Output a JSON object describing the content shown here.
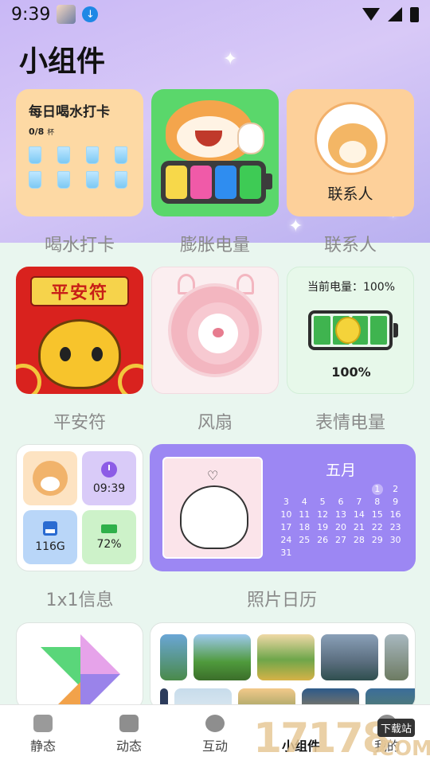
{
  "status_bar": {
    "time": "9:39",
    "icons": [
      "avatar-icon",
      "download-icon",
      "wifi-icon",
      "signal-icon",
      "battery-icon"
    ]
  },
  "page_title": "小组件",
  "widgets": {
    "water": {
      "title": "每日喝水打卡",
      "count": "0/8",
      "unit": "杯",
      "label": "喝水打卡"
    },
    "cat_battery": {
      "label": "膨胀电量"
    },
    "contact": {
      "name": "联系人",
      "label": "联系人"
    },
    "pinganfu": {
      "banner": "平安符",
      "label": "平安符"
    },
    "fan": {
      "label": "风扇"
    },
    "emoji_battery": {
      "header": "当前电量：100%",
      "percent": "100%",
      "level": 1.0,
      "label": "表情电量"
    },
    "info": {
      "time": "09:39",
      "storage": "116G",
      "battery": "72%",
      "label": "1x1信息"
    },
    "photo_calendar": {
      "month": "五月",
      "today": "1",
      "days": [
        "",
        "",
        "",
        "",
        "",
        "1",
        "2",
        "3",
        "4",
        "5",
        "6",
        "7",
        "8",
        "9",
        "10",
        "11",
        "12",
        "13",
        "14",
        "15",
        "16",
        "17",
        "18",
        "19",
        "20",
        "21",
        "22",
        "23",
        "24",
        "25",
        "26",
        "27",
        "28",
        "29",
        "30",
        "31",
        "",
        "",
        "",
        ""
      ],
      "label": "照片日历"
    }
  },
  "tabs": [
    {
      "label": "静态",
      "icon": "image-icon",
      "active": false
    },
    {
      "label": "动态",
      "icon": "star-icon",
      "active": false
    },
    {
      "label": "互动",
      "icon": "planet-icon",
      "active": false
    },
    {
      "label": "小组件",
      "icon": "widget-icon",
      "active": true
    },
    {
      "label": "我的",
      "icon": "person-icon",
      "active": false
    }
  ],
  "watermark": {
    "number": "17178",
    "tag": "下载站",
    "suffix": ".COM"
  },
  "colors": {
    "accent_purple": "#9c87f3",
    "water_bg": "#fdd9a4",
    "cat_bg": "#5ad76b",
    "contact_bg": "#fdd09a",
    "pinganfu_bg": "#d9221e"
  }
}
